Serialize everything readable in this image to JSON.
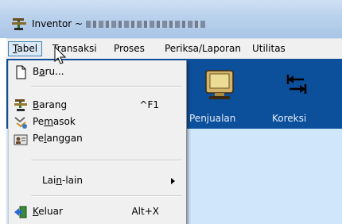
{
  "window": {
    "app_name": "Inventor",
    "title_separator": " ~ ",
    "title_redacted_text": "\"BARCODE\" BUSINESS"
  },
  "menubar": {
    "items": [
      {
        "label": "Tabel",
        "accel_index": 0
      },
      {
        "label": "Transaksi"
      },
      {
        "label": "Proses"
      },
      {
        "label": "Periksa/Laporan"
      },
      {
        "label": "Utilitas"
      }
    ]
  },
  "toolbar": {
    "buttons": [
      {
        "label": "Penjualan"
      },
      {
        "label": "Koreksi"
      }
    ]
  },
  "dropdown": {
    "items": [
      {
        "pre": "B",
        "accel": "a",
        "post": "ru...",
        "icon": "new-document-icon",
        "shortcut": ""
      },
      {
        "pre": "",
        "accel": "B",
        "post": "arang",
        "icon": "goods-icon",
        "shortcut": "^F1"
      },
      {
        "pre": "Pe",
        "accel": "m",
        "post": "asok",
        "icon": "supplier-icon",
        "shortcut": ""
      },
      {
        "pre": "Pe",
        "accel": "l",
        "post": "anggan",
        "icon": "customer-icon",
        "shortcut": ""
      },
      {
        "pre": "Lai",
        "accel": "n",
        "post": "-lain",
        "icon": "",
        "shortcut": ""
      },
      {
        "pre": "",
        "accel": "K",
        "post": "eluar",
        "icon": "exit-icon",
        "shortcut": "Alt+X"
      }
    ]
  },
  "colors": {
    "toolbar_bg": "#0c4f9b",
    "content_bg": "#cfe6fb",
    "menu_bg": "#f0f0f0",
    "active_menu_border": "#3c7fb1"
  }
}
